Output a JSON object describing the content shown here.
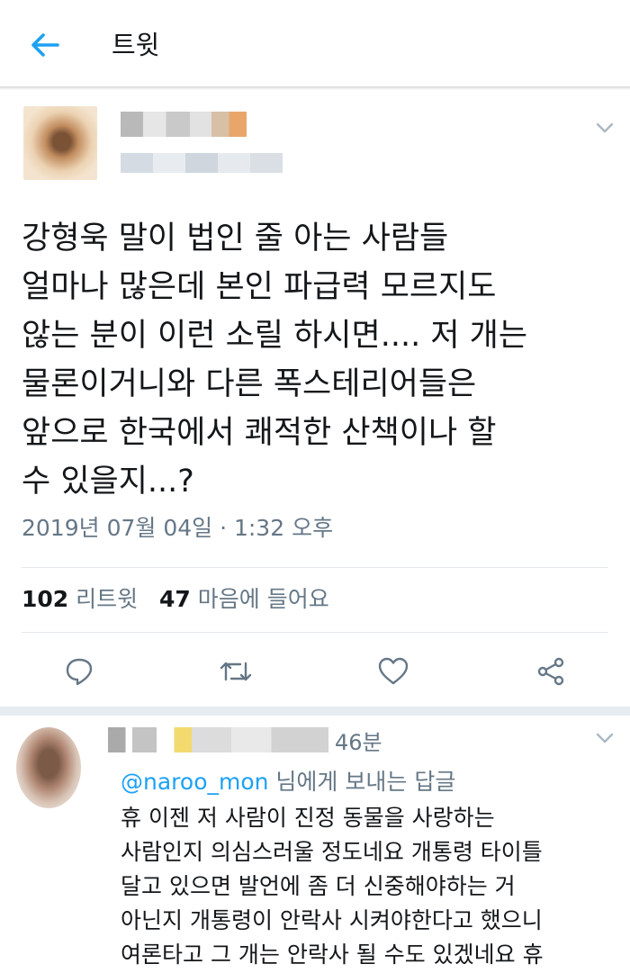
{
  "header": {
    "title": "트윗",
    "back_icon": "arrow-left-icon",
    "accent": "#1da1f2"
  },
  "tweet": {
    "text": "강형욱 말이 법인 줄 아는 사람들\n얼마나 많은데 본인 파급력 모르지도\n않는 분이 이런 소릴 하시면.... 저 개는\n물론이거니와 다른 폭스테리어들은\n앞으로 한국에서 쾌적한 산책이나 할\n수 있을지...?",
    "timestamp": "2019년 07월 04일 · 1:32 오후",
    "retweet_count": "102",
    "retweet_label": "리트윗",
    "like_count": "47",
    "like_label": "마음에 들어요"
  },
  "actions": [
    "reply-icon",
    "retweet-icon",
    "like-icon",
    "share-icon"
  ],
  "reply": {
    "time": "46분",
    "mention": "@naroo_mon",
    "reply_suffix": " 님에게 보내는 답글",
    "text": "휴 이젠 저 사람이 진정 동물을 사랑하는\n사람인지 의심스러울 정도네요 개통령 타이틀\n달고 있으면 발언에 좀 더 신중해야하는 거\n아닌지 개통령이 안락사 시켜야한다고 했으니\n여론타고 그 개는 안락사 될 수도 있겠네요 휴"
  },
  "colors": {
    "text": "#14171a",
    "secondary": "#657786",
    "link": "#1da1f2",
    "divider": "#e1e8ed"
  }
}
